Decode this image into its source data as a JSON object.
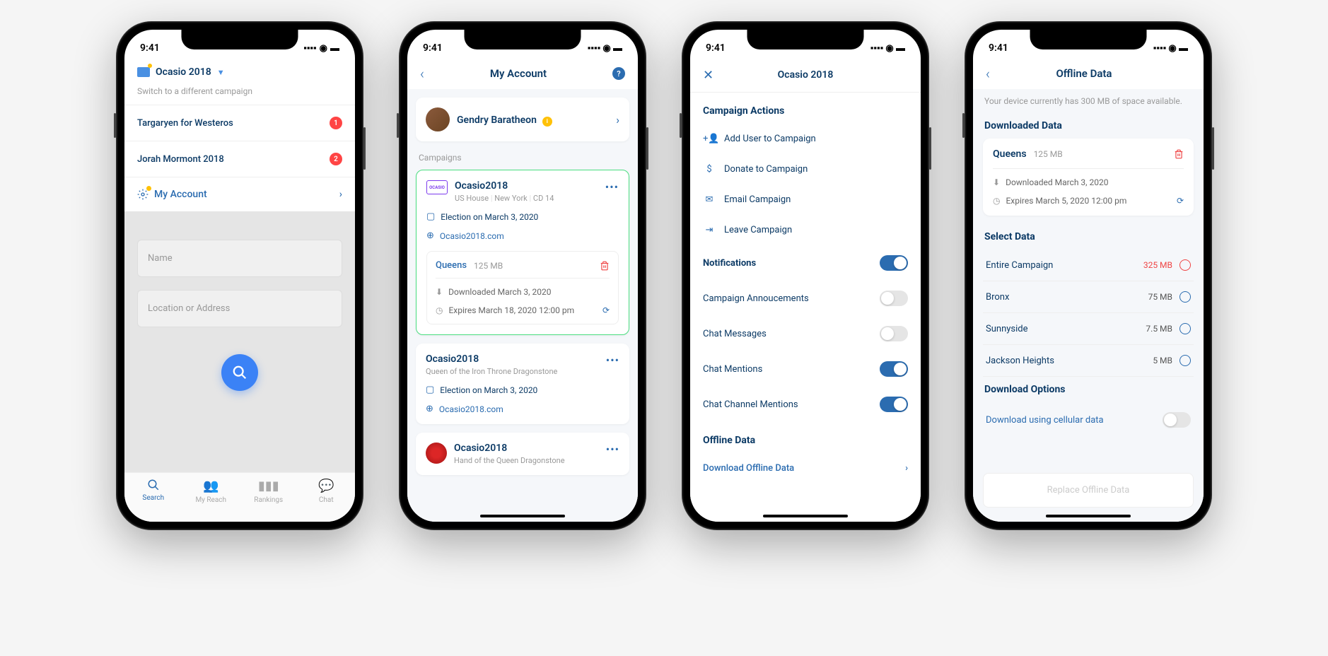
{
  "status": {
    "time": "9:41"
  },
  "screen1": {
    "campaign": "Ocasio 2018",
    "subtitle": "Switch to a different campaign",
    "items": [
      {
        "label": "Targaryen for Westeros",
        "count": "1"
      },
      {
        "label": "Jorah Mormont 2018",
        "count": "2"
      }
    ],
    "account": "My Account",
    "name_placeholder": "Name",
    "location_placeholder": "Location or Address",
    "tabs": [
      "Search",
      "My Reach",
      "Rankings",
      "Chat"
    ]
  },
  "screen2": {
    "title": "My Account",
    "user": "Gendry Baratheon",
    "section": "Campaigns",
    "camp1": {
      "name": "Ocasio2018",
      "meta1": "US House",
      "meta2": "New York",
      "meta3": "CD 14",
      "election": "Election on March 3, 2020",
      "url": "Ocasio2018.com",
      "area": "Queens",
      "size": "125 MB",
      "downloaded": "Downloaded March 3, 2020",
      "expires": "Expires March 18, 2020 12:00 pm"
    },
    "camp2": {
      "name": "Ocasio2018",
      "meta": "Queen of the Iron Throne  Dragonstone",
      "election": "Election on March 3, 2020",
      "url": "Ocasio2018.com"
    },
    "camp3": {
      "name": "Ocasio2018",
      "meta": "Hand of the Queen  Dragonstone"
    }
  },
  "screen3": {
    "title": "Ocasio 2018",
    "section_actions": "Campaign Actions",
    "actions": [
      "Add User to Campaign",
      "Donate to Campaign",
      "Email Campaign",
      "Leave Campaign"
    ],
    "section_notif": "Notifications",
    "notifs": [
      {
        "label": "Campaign Annoucements",
        "on": false
      },
      {
        "label": "Chat Messages",
        "on": false
      },
      {
        "label": "Chat Mentions",
        "on": true
      },
      {
        "label": "Chat Channel Mentions",
        "on": true
      }
    ],
    "section_offline": "Offline Data",
    "offline_link": "Download Offline Data"
  },
  "screen4": {
    "title": "Offline Data",
    "note": "Your device currently has 300 MB of space available.",
    "section_downloaded": "Downloaded Data",
    "dl": {
      "area": "Queens",
      "size": "125 MB",
      "downloaded": "Downloaded March 3, 2020",
      "expires": "Expires March 5, 2020 12:00 pm"
    },
    "section_select": "Select Data",
    "options": [
      {
        "label": "Entire Campaign",
        "size": "325 MB",
        "red": true
      },
      {
        "label": "Bronx",
        "size": "75 MB"
      },
      {
        "label": "Sunnyside",
        "size": "7.5 MB"
      },
      {
        "label": "Jackson Heights",
        "size": "5 MB"
      }
    ],
    "section_opts": "Download Options",
    "cellular": "Download using cellular data",
    "button": "Replace Offline Data"
  }
}
